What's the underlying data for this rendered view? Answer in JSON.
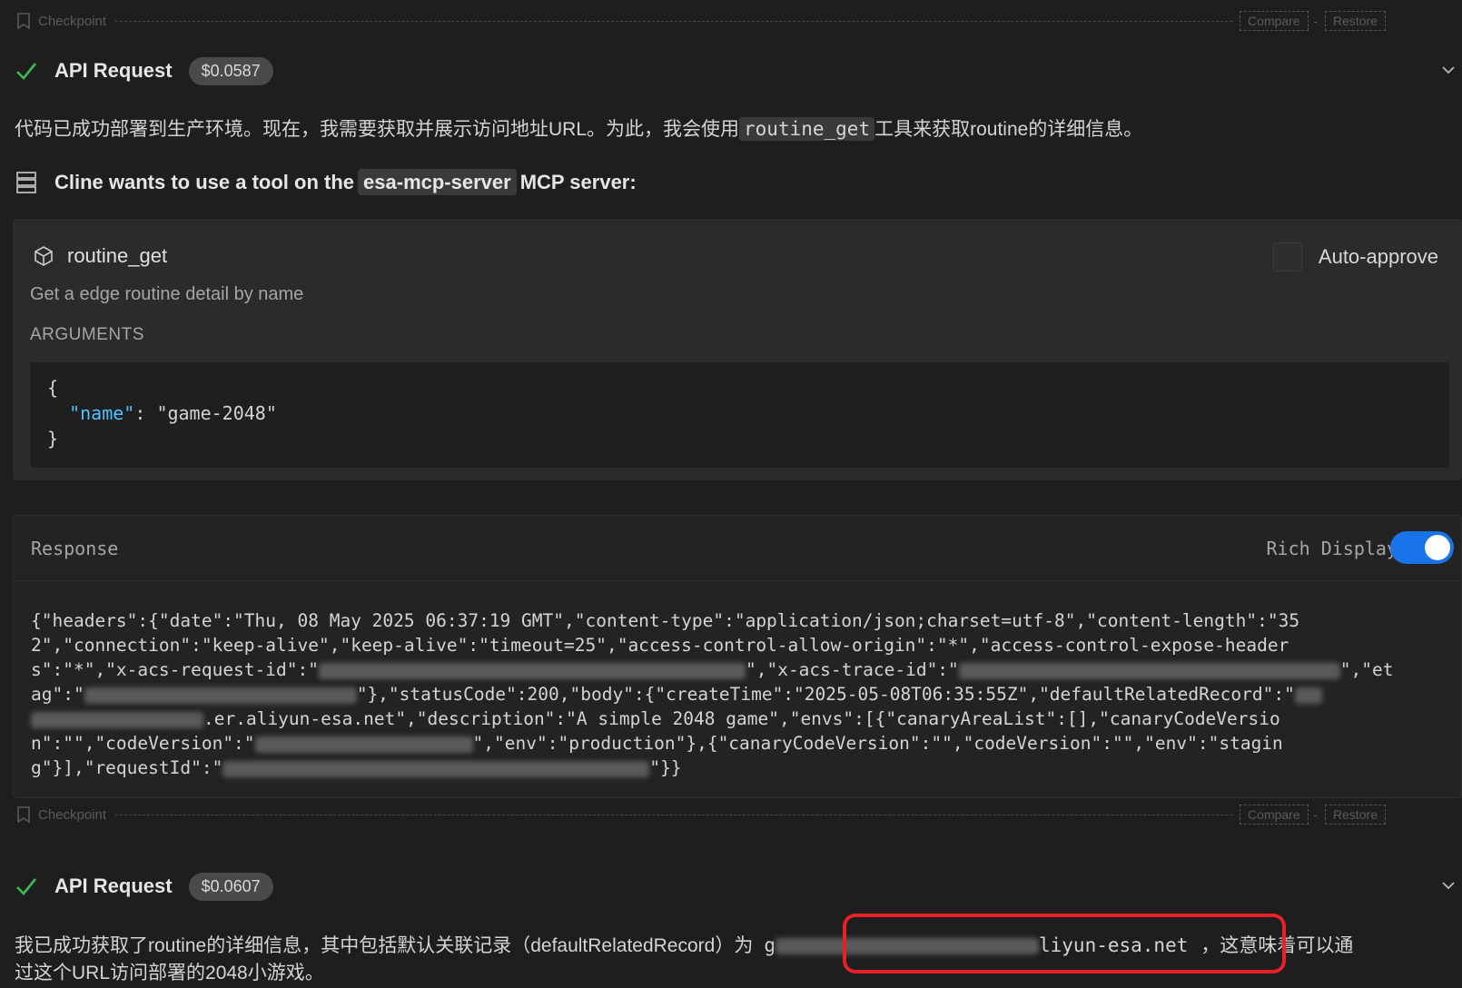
{
  "checkpoint1": {
    "label": "Checkpoint",
    "compare": "Compare",
    "restore": "Restore"
  },
  "api1": {
    "title": "API Request",
    "cost": "$0.0587"
  },
  "para1": {
    "before": "代码已成功部署到生产环境。现在，我需要获取并展示访问地址URL。为此，我会使用",
    "code": "routine_get",
    "after": "工具来获取routine的详细信息。"
  },
  "mcp": {
    "before": "Cline wants to use a tool on the",
    "server": "esa-mcp-server",
    "after": "MCP server:"
  },
  "tool": {
    "name": "routine_get",
    "auto_approve": "Auto-approve",
    "description": "Get a edge routine detail by name",
    "arguments_title": "ARGUMENTS",
    "arg_key": "\"name\"",
    "arg_value": "\"game-2048\""
  },
  "response": {
    "title": "Response",
    "rich_display": "Rich Display",
    "lines": [
      "{\"headers\":{\"date\":\"Thu, 08 May 2025 06:37:19 GMT\",\"content-type\":\"application/json;charset=utf-8\",\"content-length\":\"35",
      "2\",\"connection\":\"keep-alive\",\"keep-alive\":\"timeout=25\",\"access-control-allow-origin\":\"*\",\"access-control-expose-header",
      "s\":\"*\",\"x-acs-request-id\":\"",
      "\",\"x-acs-trace-id\":\"",
      "\",\"et",
      "ag\":\"",
      "\"},\"statusCode\":200,\"body\":{\"createTime\":\"2025-05-08T06:35:55Z\",\"defaultRelatedRecord\":\"",
      ".er.aliyun-esa.net\",\"description\":\"A simple 2048 game\",\"envs\":[{\"canaryAreaList\":[],\"canaryCodeVersio",
      "n\":\"\",\"codeVersion\":\"",
      "\",\"env\":\"production\"},{\"canaryCodeVersion\":\"\",\"codeVersion\":\"\",\"env\":\"stagin",
      "g\"}],\"requestId\":\"",
      "\"}}"
    ]
  },
  "checkpoint2": {
    "label": "Checkpoint",
    "compare": "Compare",
    "restore": "Restore"
  },
  "api2": {
    "title": "API Request",
    "cost": "$0.0607"
  },
  "para2": {
    "before": "我已成功获取了routine的详细信息，其中包括默认关联记录（defaultRelatedRecord）为",
    "url_prefix": "g",
    "url_suffix": "liyun-esa.net",
    "after": "，这意味着可以通",
    "line2": "过这个URL访问部署的2048小游戏。"
  }
}
